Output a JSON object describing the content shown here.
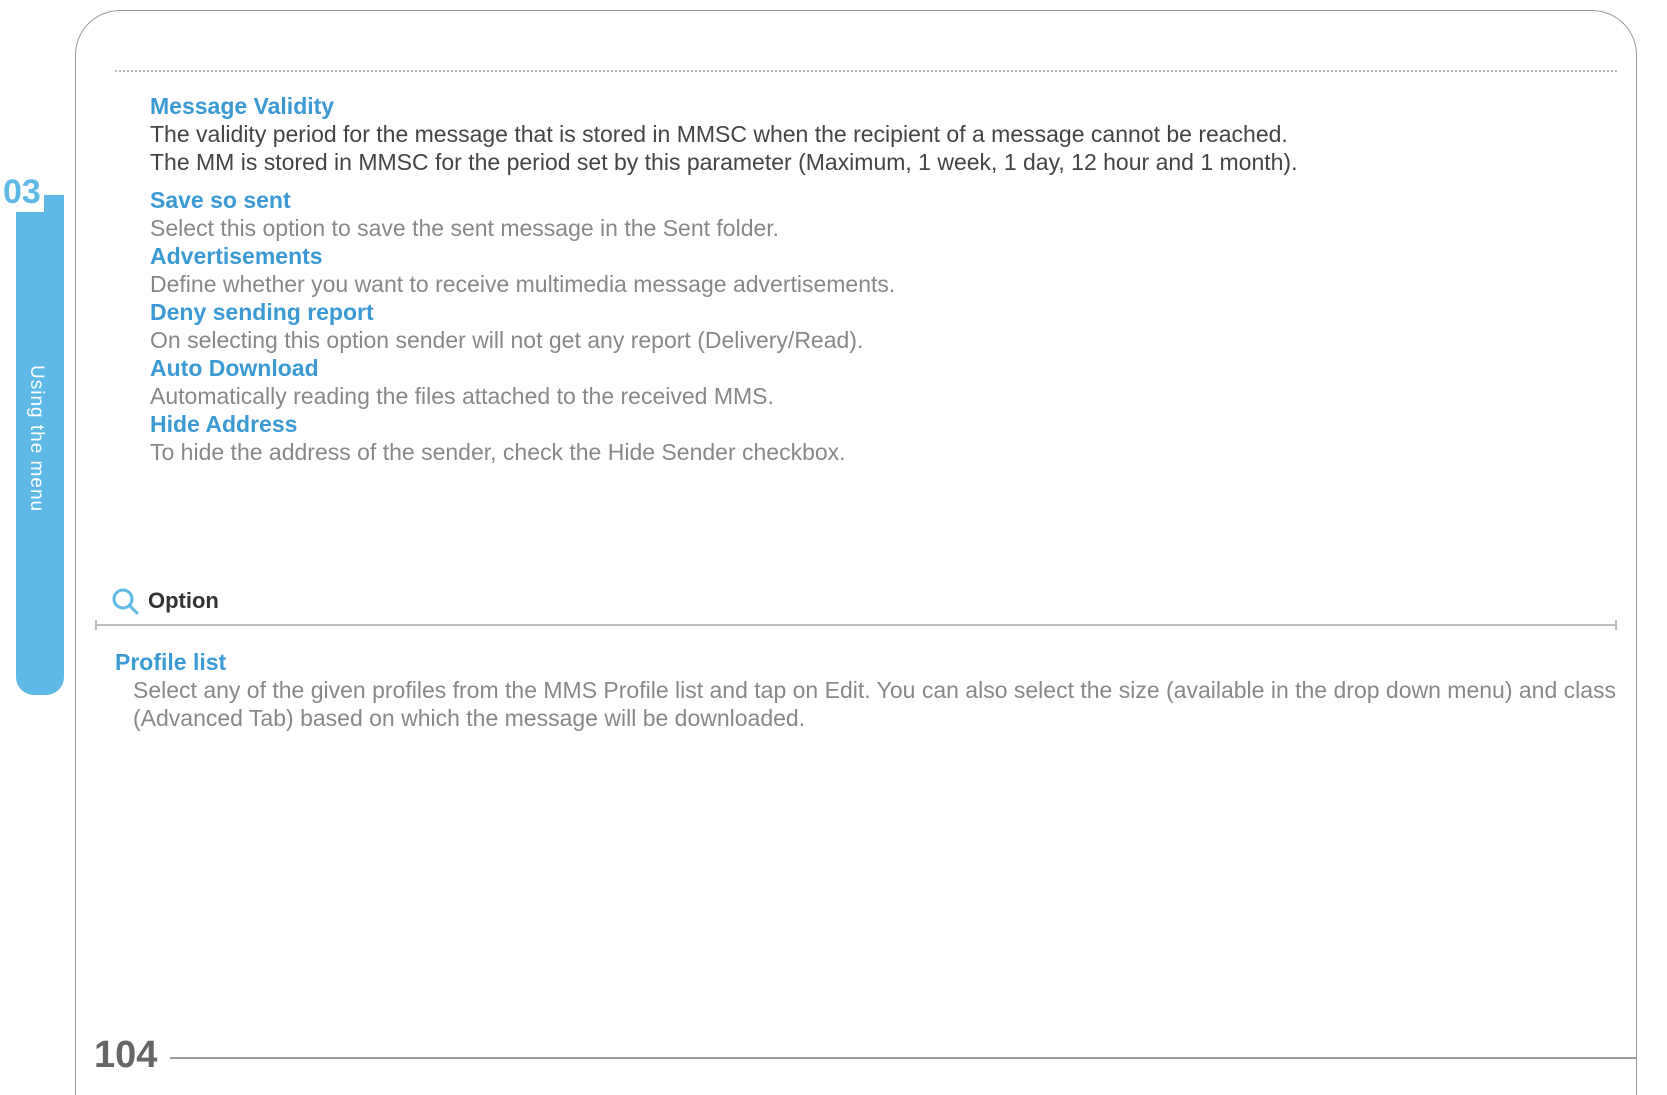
{
  "chapter": "03",
  "sidebar": {
    "label": "Using the menu"
  },
  "page_number": "104",
  "sections": {
    "message_validity": {
      "heading": "Message Validity",
      "body1": "The validity period for the message that is stored in MMSC when the recipient of a message cannot be reached.",
      "body2": "The MM is stored in MMSC for the period set by this parameter (Maximum, 1 week, 1 day, 12 hour and 1 month)."
    },
    "save_so_sent": {
      "heading": "Save so sent",
      "body": "Select this option to save the sent message in the Sent folder."
    },
    "advertisements": {
      "heading": "Advertisements",
      "body": "Define whether you want to receive multimedia message advertisements."
    },
    "deny_sending_report": {
      "heading": "Deny sending report",
      "body": "On selecting this option sender will not get any report (Delivery/Read)."
    },
    "auto_download": {
      "heading": "Auto Download",
      "body": "Automatically reading the files attached to the received MMS."
    },
    "hide_address": {
      "heading": "Hide Address",
      "body": "To hide the address of the sender, check the Hide Sender checkbox."
    }
  },
  "option": {
    "label": "Option",
    "profile_list": {
      "heading": "Profile list",
      "body": "Select any of the given profiles from the MMS Profile list and tap on Edit. You can also select the size (available in the drop down menu) and class (Advanced Tab) based on which the message will be downloaded."
    }
  }
}
